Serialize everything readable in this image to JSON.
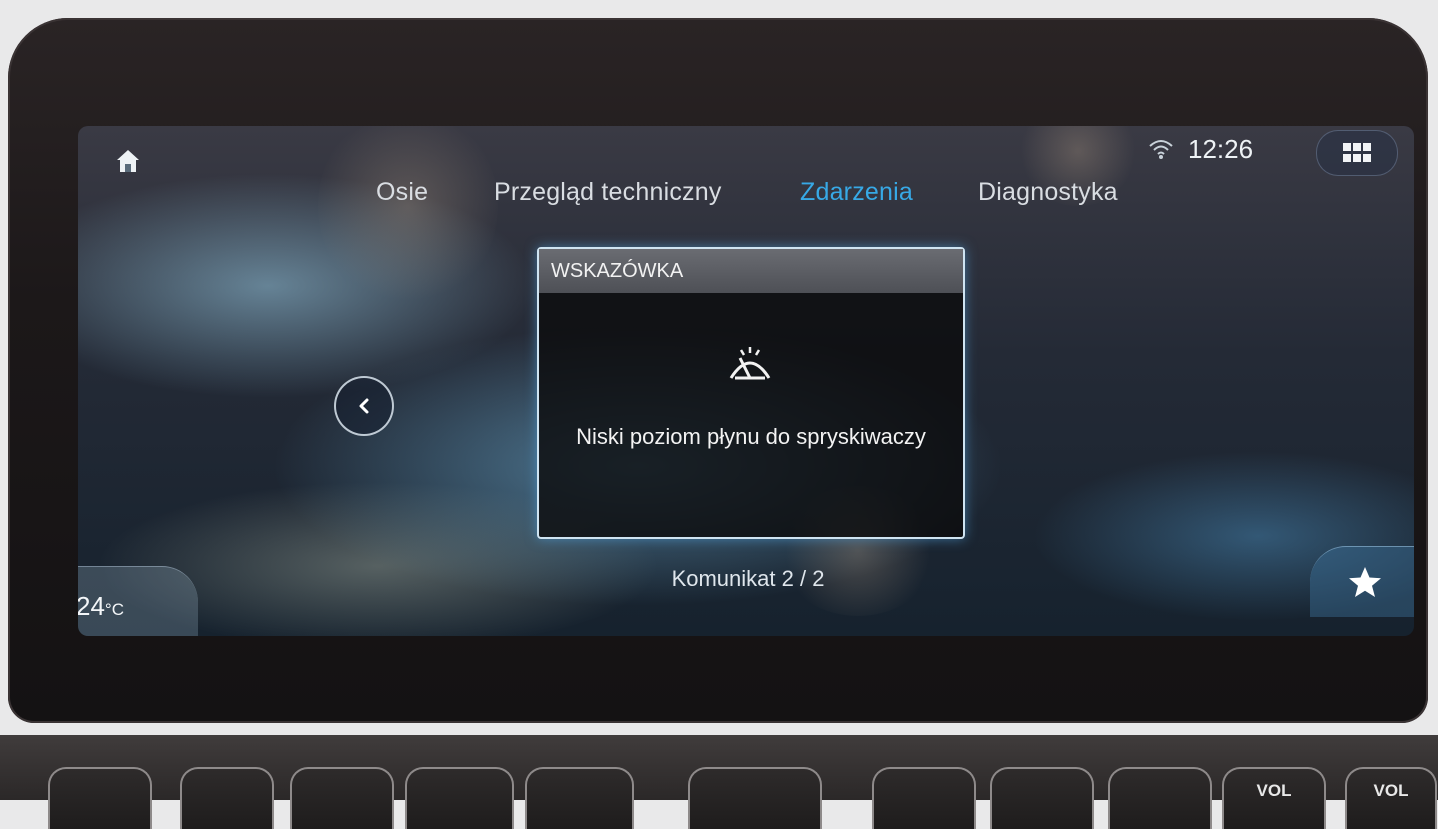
{
  "status_bar": {
    "time": "12:26",
    "home_icon": "home-icon",
    "signal_icon": "wifi-icon",
    "menu_icon": "grid-icon"
  },
  "tabs": [
    {
      "label": "Osie",
      "active": false
    },
    {
      "label": "Przegląd techniczny",
      "active": false
    },
    {
      "label": "Zdarzenia",
      "active": true
    },
    {
      "label": "Diagnostyka",
      "active": false
    }
  ],
  "dialog": {
    "header": "WSKAZÓWKA",
    "icon": "washer-fluid-icon",
    "message": "Niski poziom płynu do spryskiwaczy"
  },
  "counter": "Komunikat 2 / 2",
  "climate": {
    "temperature": "24",
    "unit": "°C"
  },
  "favorites_icon": "star-icon",
  "hardware_buttons": {
    "vol_down": "VOL",
    "vol_up": "VOL"
  },
  "colors": {
    "active_tab": "#37a9e6",
    "dialog_border": "#cfe4f2"
  }
}
